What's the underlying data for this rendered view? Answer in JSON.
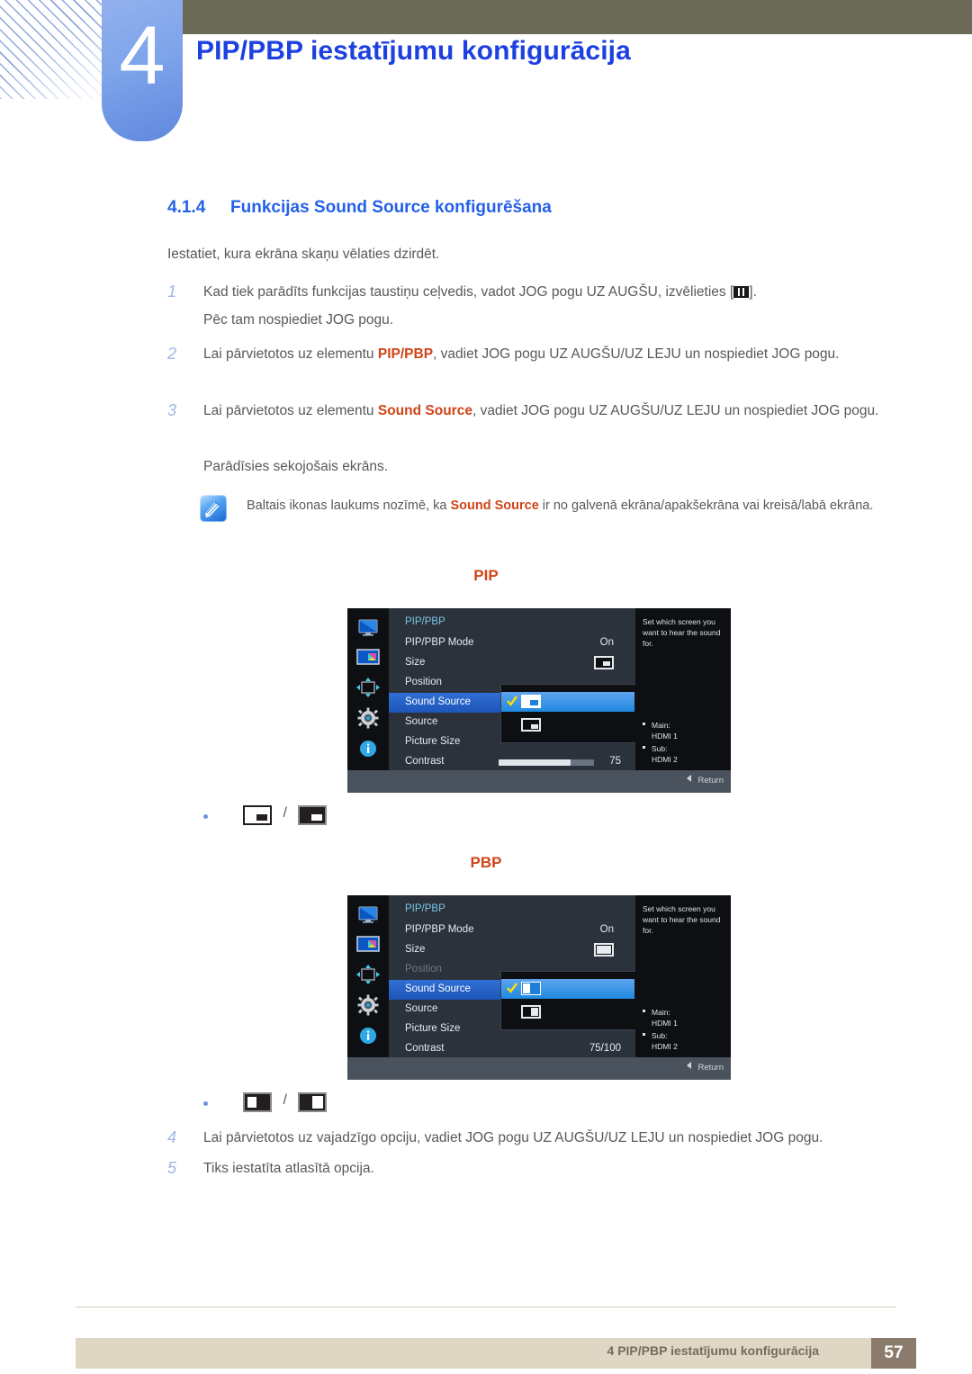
{
  "header": {
    "chapter_number": "4",
    "chapter_title": "PIP/PBP iestatījumu konfigurācija"
  },
  "section": {
    "number": "4.1.4",
    "title": "Funkcijas Sound Source konfigurēšana",
    "lead": "Iestatiet, kura ekrāna skaņu vēlaties dzirdēt."
  },
  "steps": [
    {
      "index": "1",
      "line1_pre": "Kad tiek parādīts funkcijas taustiņu ceļvedis, vadot JOG pogu UZ AUGŠU, izvēlieties [",
      "line1_post": "].",
      "line2": "Pēc tam nospiediet JOG pogu."
    },
    {
      "index": "2",
      "pre": "Lai pārvietotos uz elementu ",
      "highlight": "PIP/PBP",
      "post": ", vadiet JOG pogu UZ AUGŠU/UZ LEJU un nospiediet JOG pogu."
    },
    {
      "index": "3",
      "pre": "Lai pārvietotos uz elementu ",
      "highlight": "Sound Source",
      "post": ", vadiet JOG pogu UZ AUGŠU/UZ LEJU un nospiediet JOG pogu.",
      "sub": "Parādīsies sekojošais ekrāns."
    },
    {
      "index": "4",
      "text": "Lai pārvietotos uz vajadzīgo opciju, vadiet JOG pogu UZ AUGŠU/UZ LEJU un nospiediet JOG pogu."
    },
    {
      "index": "5",
      "text": "Tiks iestatīta atlasītā opcija."
    }
  ],
  "note": {
    "icon": "note-pen-icon",
    "pre": "Baltais ikonas laukums nozīmē, ka ",
    "highlight": "Sound Source",
    "post": " ir no galvenā ekrāna/apakšekrāna vai kreisā/labā ekrāna."
  },
  "osd_pip": {
    "caption": "PIP",
    "menu_title": "PIP/PBP",
    "rows": [
      {
        "label": "PIP/PBP Mode",
        "value": "On"
      },
      {
        "label": "Size",
        "value": ""
      },
      {
        "label": "Position",
        "value": ""
      },
      {
        "label": "Sound Source",
        "value": ""
      },
      {
        "label": "Source",
        "value": ""
      },
      {
        "label": "Picture Size",
        "value": ""
      },
      {
        "label": "Contrast",
        "value": "75"
      }
    ],
    "selected_row": "Sound Source",
    "contrast_percent": 75,
    "popup_options": [
      "sound-source-main-icon",
      "sound-source-sub-icon"
    ],
    "popup_selected_index": 0,
    "description": "Set which screen you want to hear the sound for.",
    "info_items": [
      {
        "label": "Main:",
        "value": "HDMI 1"
      },
      {
        "label": "Sub:",
        "value": "HDMI 2"
      }
    ],
    "return_label": "Return",
    "rail_icons": [
      "picture-icon",
      "pip-pbp-icon",
      "onscreen-display-icon",
      "system-gear-icon",
      "information-icon"
    ],
    "rail_selected_index": 1
  },
  "osd_pbp": {
    "caption": "PBP",
    "menu_title": "PIP/PBP",
    "rows": [
      {
        "label": "PIP/PBP Mode",
        "value": "On"
      },
      {
        "label": "Size",
        "value": ""
      },
      {
        "label": "Position",
        "value": "",
        "disabled": true
      },
      {
        "label": "Sound Source",
        "value": ""
      },
      {
        "label": "Source",
        "value": ""
      },
      {
        "label": "Picture Size",
        "value": ""
      },
      {
        "label": "Contrast",
        "value": "75/100"
      }
    ],
    "selected_row": "Sound Source",
    "popup_options": [
      "sound-source-left-icon",
      "sound-source-right-icon"
    ],
    "popup_selected_index": 0,
    "description": "Set which screen you want to hear the sound for.",
    "info_items": [
      {
        "label": "Main:",
        "value": "HDMI 1"
      },
      {
        "label": "Sub:",
        "value": "HDMI 2"
      }
    ],
    "return_label": "Return",
    "rail_icons": [
      "picture-icon",
      "pip-pbp-icon",
      "onscreen-display-icon",
      "system-gear-icon",
      "information-icon"
    ],
    "rail_selected_index": 1
  },
  "bullets": [
    {
      "icons": [
        "pip-main-white-icon",
        "pip-sub-white-icon"
      ],
      "separator": "/"
    },
    {
      "icons": [
        "pbp-left-white-icon",
        "pbp-right-white-icon"
      ],
      "separator": "/"
    }
  ],
  "footer": {
    "text": "4 PIP/PBP iestatījumu konfigurācija",
    "page": "57"
  },
  "colors": {
    "accent_blue": "#2561e8",
    "highlight_orange": "#d14417",
    "header_olive": "#6b6a56",
    "tab_blue": "#7ea4ea",
    "footer_bar": "#ddd7c4",
    "footer_page": "#8a7b6d"
  }
}
